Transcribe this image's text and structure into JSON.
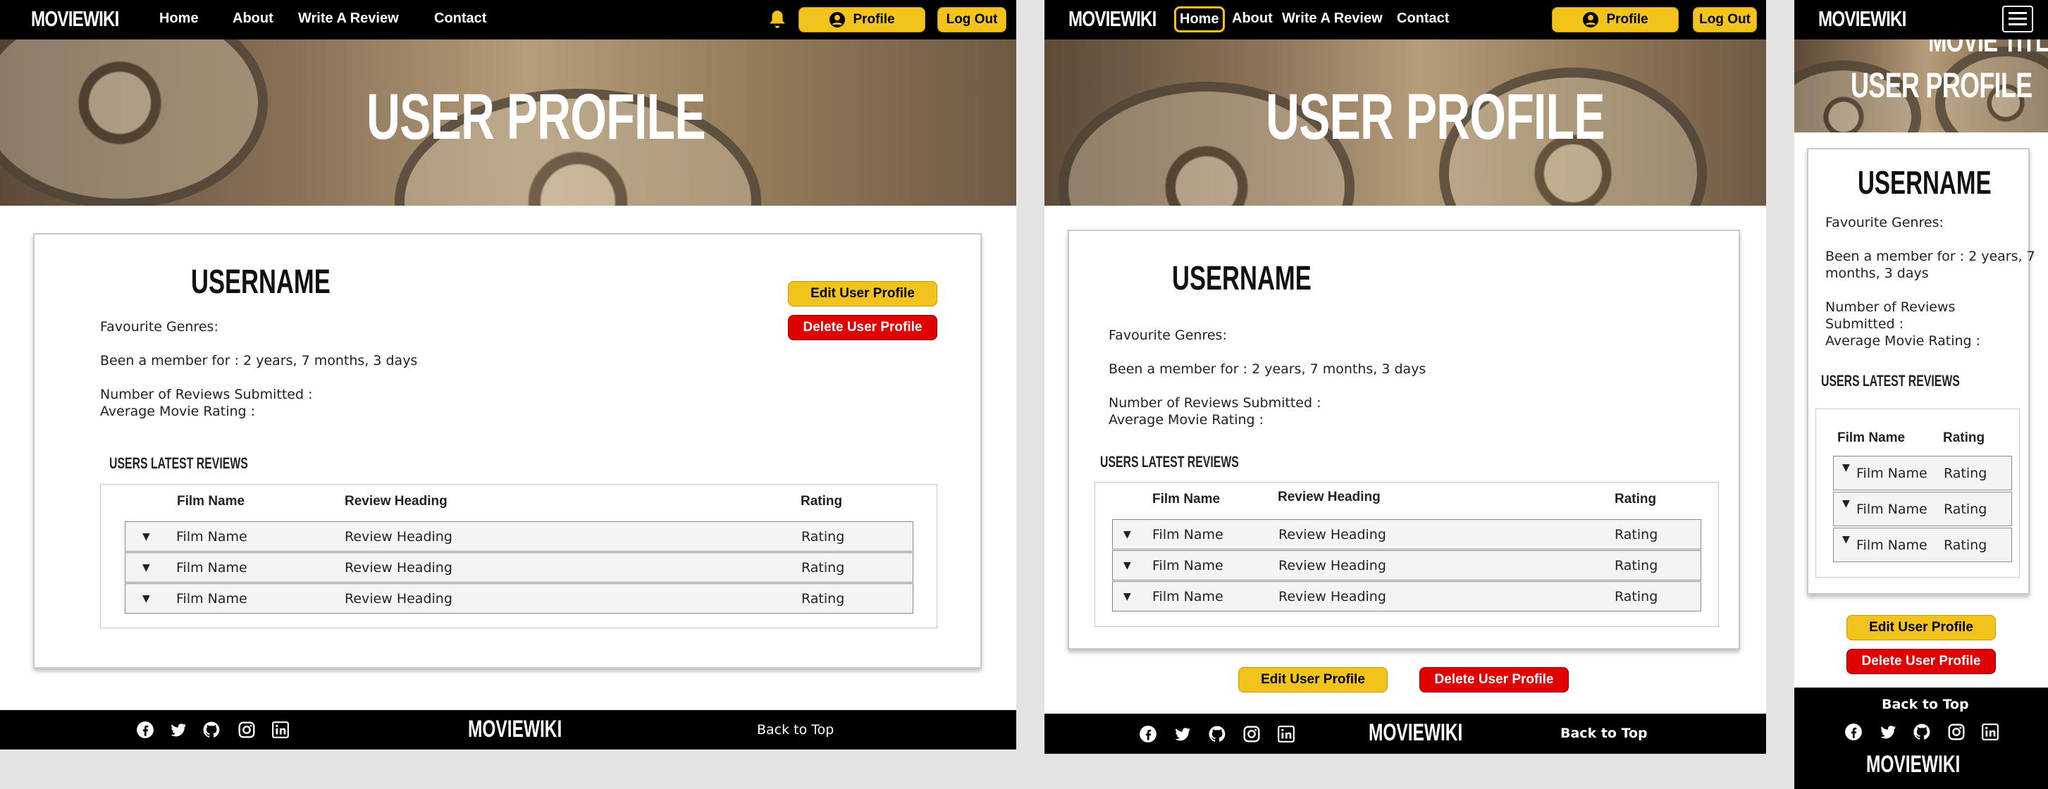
{
  "brand": "MOVIEWIKI",
  "nav": {
    "home": "Home",
    "about": "About",
    "write_review": "Write A Review",
    "contact": "Contact",
    "profile": "Profile",
    "logout": "Log Out"
  },
  "hero": {
    "title": "USER PROFILE",
    "partial_title_mobile": "MOVIE TITLE"
  },
  "profile": {
    "username": "USERNAME",
    "favourite_genres": "Favourite Genres:",
    "member_for": "Been a member for : 2 years, 7 months, 3 days",
    "member_for_line1": "Been a member for : 2 years, 7",
    "member_for_line2": "months, 3 days",
    "reviews_submitted": "Number of Reviews Submitted :",
    "reviews_line1": "Number of Reviews",
    "reviews_line2": "Submitted :",
    "avg_rating": "Average Movie Rating :",
    "edit_button": "Edit User Profile",
    "delete_button": "Delete User Profile"
  },
  "reviews": {
    "section_title": "USERS LATEST REVIEWS",
    "headers": {
      "film": "Film Name",
      "heading": "Review Heading",
      "rating": "Rating"
    },
    "rows": [
      {
        "film": "Film Name",
        "heading": "Review Heading",
        "rating": "Rating"
      },
      {
        "film": "Film Name",
        "heading": "Review Heading",
        "rating": "Rating"
      },
      {
        "film": "Film Name",
        "heading": "Review Heading",
        "rating": "Rating"
      }
    ]
  },
  "footer": {
    "logo": "MOVIEWIKI",
    "back_to_top": "Back to Top"
  },
  "colors": {
    "nav_bg": "#000000",
    "accent_yellow": "#f2c31d",
    "danger_red": "#e00000",
    "active_outline": "#f2c31d"
  },
  "icons": [
    "bell-icon",
    "user-circle-icon",
    "facebook-icon",
    "twitter-icon",
    "github-icon",
    "instagram-icon",
    "linkedin-icon",
    "hamburger-menu-icon",
    "caret-down-icon"
  ]
}
